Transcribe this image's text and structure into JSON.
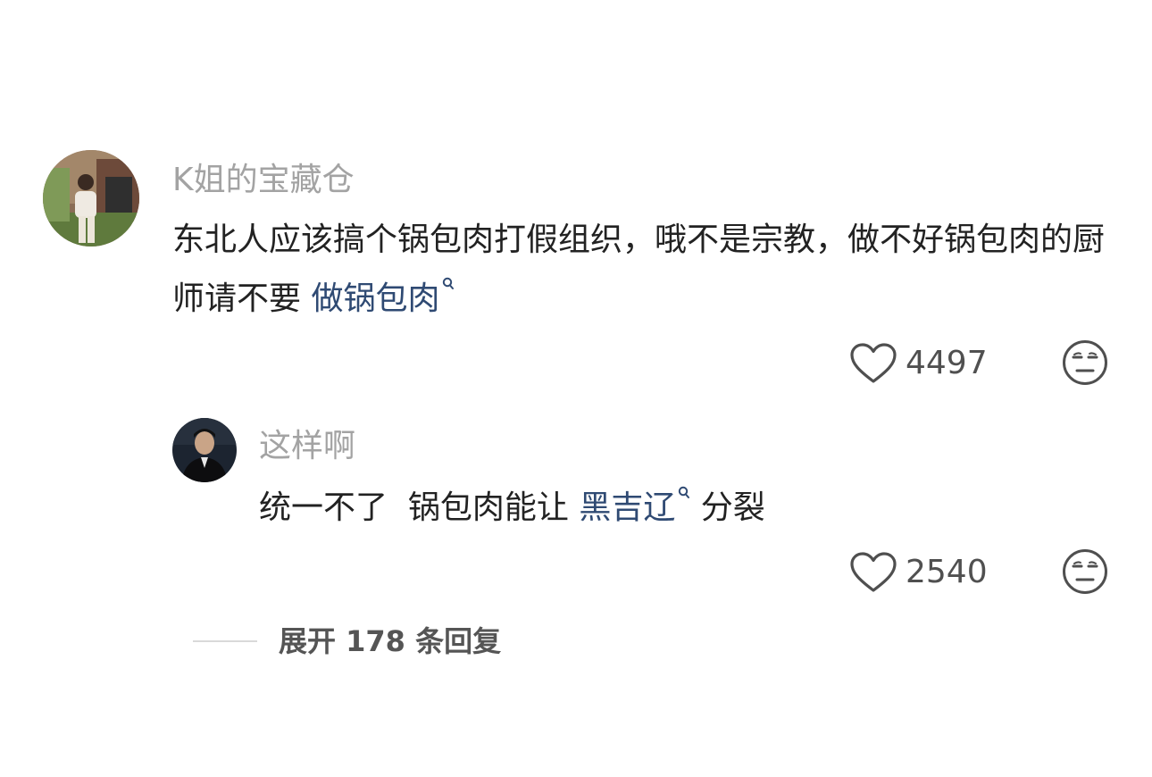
{
  "comment": {
    "author": "K姐的宝藏仓",
    "text_plain": "东北人应该搞个锅包肉打假组织，哦不是宗教，做不好锅包肉的厨师请不要",
    "search_link": "做锅包肉",
    "likes": "4497",
    "avatar_icon": "user-photo-avatar",
    "like_icon": "heart-outline-icon",
    "dislike_icon": "unamused-face-icon"
  },
  "reply": {
    "author": "这样啊",
    "text_before": "统一不了  锅包肉能让 ",
    "search_link": "黑吉辽",
    "text_after": " 分裂",
    "likes": "2540",
    "avatar_icon": "user-photo-avatar",
    "like_icon": "heart-outline-icon",
    "dislike_icon": "unamused-face-icon"
  },
  "expand": {
    "label": "展开 178 条回复"
  },
  "colors": {
    "link": "#2f4a73",
    "username": "#a3a3a3",
    "text": "#222222",
    "count": "#505050"
  }
}
